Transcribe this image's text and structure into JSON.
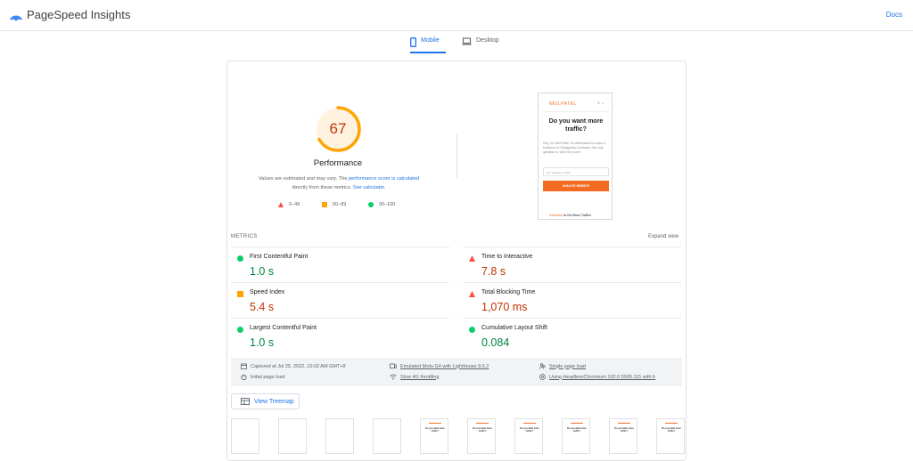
{
  "header": {
    "title": "PageSpeed Insights",
    "docs_label": "Docs"
  },
  "tabs": [
    {
      "label": "Mobile",
      "icon": "smartphone-icon",
      "active": true
    },
    {
      "label": "Desktop",
      "icon": "laptop-icon",
      "active": false
    }
  ],
  "performance": {
    "score": "67",
    "score_fraction": 0.67,
    "label": "Performance",
    "disclaimer_prefix": "Values are estimated and may vary. The",
    "disclaimer_link1": "performance score is calculated",
    "disclaimer_middle": "directly from these metrics.",
    "disclaimer_link2": "See calculator.",
    "legend": [
      {
        "range": "0–49",
        "shape": "triangle",
        "color": "#ff4e42"
      },
      {
        "range": "50–89",
        "shape": "square",
        "color": "#ffa400"
      },
      {
        "range": "90–100",
        "shape": "circle",
        "color": "#0cce6b"
      }
    ]
  },
  "screenshot": {
    "logo": "NEILPATEL",
    "menu": "≡ ⌄",
    "headline": "Do you want more traffic?",
    "body": "Hey, I'm Neil Patel. I'm determined to make a business in Chicago/top conductor. My only question is, will it be yours?",
    "input_placeholder": "Your website or URL",
    "button": "ANALYZE WEBSITE",
    "footer_link": "Subscribe",
    "footer_text": "to Get More Traffic!"
  },
  "metrics": {
    "title": "METRICS",
    "expand_label": "Expand view",
    "items": [
      {
        "name": "First Contentful Paint",
        "value": "1.0 s",
        "status": "pass"
      },
      {
        "name": "Time to Interactive",
        "value": "7.8 s",
        "status": "fail"
      },
      {
        "name": "Speed Index",
        "value": "5.4 s",
        "status": "average"
      },
      {
        "name": "Total Blocking Time",
        "value": "1,070 ms",
        "status": "fail"
      },
      {
        "name": "Largest Contentful Paint",
        "value": "1.0 s",
        "status": "pass"
      },
      {
        "name": "Cumulative Layout Shift",
        "value": "0.084",
        "status": "pass"
      }
    ]
  },
  "run_info": {
    "captured": "Captured at Jul 25, 2022, 10:02 AM GMT+8",
    "initial_load": "Initial page load",
    "device": "Emulated Moto G4 with Lighthouse 9.6.2",
    "throttling": "Slow 4G throttling",
    "session": "Single page load",
    "browser": "Using HeadlessChromium 102.0.5005.115 with lr"
  },
  "treemap": {
    "label": "View Treemap"
  },
  "filmstrip": {
    "thumb_headline": "Do you want more traffic?"
  },
  "colors": {
    "fail": "#c33300",
    "pass": "#018642",
    "average": "#ffa400",
    "accent": "#1a73e8"
  }
}
